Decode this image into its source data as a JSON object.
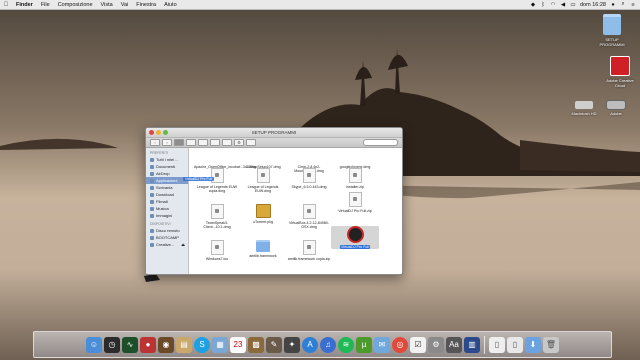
{
  "menubar": {
    "apple": "",
    "items": [
      "Finder",
      "File",
      "Composizione",
      "Vista",
      "Vai",
      "Finestra",
      "Aiuto"
    ],
    "clock": "dom 16:28"
  },
  "desktop": {
    "icons": [
      {
        "label": "SETUP PROGRAMMI",
        "kind": "folder"
      },
      {
        "label": "Adobe Creative Cloud",
        "kind": "adobe"
      },
      {
        "label": "Macintosh HD",
        "kind": "drive"
      },
      {
        "label": "Adobe",
        "kind": "drive"
      }
    ]
  },
  "finder": {
    "title": "SETUP PROGRAMMI",
    "search_placeholder": "",
    "sidebar": {
      "favorites_header": "PREFERITI",
      "favorites": [
        "Tutti i miei ...",
        "Documenti",
        "AirDrop",
        "Applicazioni",
        "Scrivania",
        "Download",
        "Filmati",
        "Musica",
        "Immagini"
      ],
      "devices_header": "DISPOSITIVI",
      "devices": [
        "Disco remoto",
        "BOOTCAMP",
        "Creative..."
      ]
    },
    "files": [
      {
        "name": "Apache_OpenOffice_incubat...3.4.dmg",
        "kind": "doc"
      },
      {
        "name": "CCMacSetup107.dmg",
        "kind": "doc"
      },
      {
        "name": "Cimp-2.8.4p2-MountainLion.dmg",
        "kind": "doc"
      },
      {
        "name": "googlechrome.dmg",
        "kind": "doc"
      },
      {
        "name": "League of Legends EUW copia.dmg",
        "kind": "doc"
      },
      {
        "name": "League of Legends EUW.dmg",
        "kind": "doc"
      },
      {
        "name": "Skype_6.5.0.443.dmg",
        "kind": "doc"
      },
      {
        "name": "installer.zip",
        "kind": "doc"
      },
      {
        "name": "VirtualDJ Pro Full.zip",
        "kind": "doc"
      },
      {
        "name": "TeamSpeak3-Client...10.1.dmg",
        "kind": "doc"
      },
      {
        "name": "uTorrent.pkg",
        "kind": "pkg"
      },
      {
        "name": "VirtualBox-4.2.12-84980-OSX.dmg",
        "kind": "doc"
      },
      {
        "name": "VirtualDJ Pro Full",
        "kind": "app"
      },
      {
        "name": "Windows7.iso",
        "kind": "doc"
      },
      {
        "name": "amtlib.framework",
        "kind": "folder"
      },
      {
        "name": "amtlib.framework copia.zip",
        "kind": "doc"
      }
    ],
    "drag_label": "VirtualDJ Pro Full"
  },
  "dock": {
    "items": [
      "finder",
      "dashboard",
      "activity-monitor",
      "photo-booth",
      "game",
      "calibre",
      "skype",
      "preview",
      "calendar",
      "photos",
      "gimp",
      "fcpx",
      "app-store",
      "itunes",
      "spotify",
      "utorrent",
      "mail",
      "chrome",
      "reminders",
      "system-preferences",
      "dictionary",
      "launchpad",
      "document",
      "document2",
      "downloads",
      "trash"
    ]
  },
  "colors": {
    "selection": "#2f6fd6",
    "sidebar": "#e3e8ee"
  }
}
